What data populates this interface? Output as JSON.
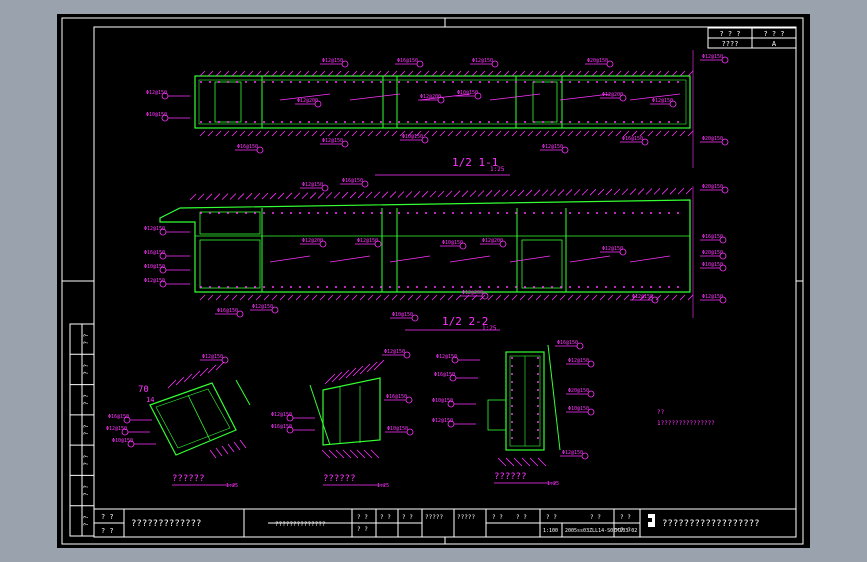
{
  "colors": {
    "workspace": "#9aa3ad",
    "paper": "#000000",
    "frame": "#ffffff",
    "concrete": "#33ff33",
    "rebar": "#ff33ff",
    "hatch": "#ff33ff",
    "text": "#ffffff"
  },
  "title_block_top": {
    "r1": [
      "? ? ?",
      "? ? ?"
    ],
    "r2": [
      "????",
      "A"
    ]
  },
  "views": {
    "section1": {
      "title": "1/2 1-1",
      "scale": "1:25"
    },
    "section2": {
      "title": "1/2 2-2",
      "scale": "1:25"
    },
    "detail1": {
      "title": "??????",
      "scale": "1:25",
      "dim": "70",
      "dim2": "14"
    },
    "detail2": {
      "title": "??????",
      "scale": "1:25"
    },
    "detail3": {
      "title": "??????",
      "scale": "1:25"
    }
  },
  "note": {
    "heading": "??",
    "text": "1???????????????"
  },
  "side_strip": [
    "? ?",
    "? ?",
    "? ?",
    "? ?",
    "? ?",
    "? ?",
    "? ?"
  ],
  "title_block_bottom": {
    "c1": [
      "? ?",
      "? ?"
    ],
    "project": "?????????????",
    "subtitle": "??????????????",
    "c2": [
      "? ?",
      "? ?"
    ],
    "sign1": "? ?",
    "sign2": "? ?",
    "sign3": "? ?",
    "sign4": "? ?",
    "box1": "?????",
    "box2": "?????",
    "h1": "? ?",
    "h2": "? ?",
    "h3": "? ?",
    "h4": "? ?",
    "h5": "? ?",
    "scale": "1:100",
    "drawing_no": "2005ss03ZLL14-S0ΖΜΣ03-02",
    "date": "? ?",
    "drawing_title": "??????????????????"
  },
  "rebar_labels": {
    "a": "Φ12@150",
    "b": "Φ16@150",
    "c": "Φ20@150",
    "d": "Φ10@150",
    "e": "Φ12@200"
  }
}
